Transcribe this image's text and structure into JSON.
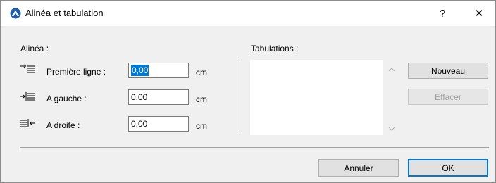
{
  "window": {
    "title": "Alinéa et tabulation",
    "help_label": "?",
    "close_label": "✕"
  },
  "indent": {
    "section_label": "Alinéa :",
    "rows": [
      {
        "label": "Première ligne :",
        "value": "0,00",
        "unit": "cm",
        "icon": "first-line-indent-icon"
      },
      {
        "label": "A gauche :",
        "value": "0,00",
        "unit": "cm",
        "icon": "left-indent-icon"
      },
      {
        "label": "A droite :",
        "value": "0,00",
        "unit": "cm",
        "icon": "right-indent-icon"
      }
    ]
  },
  "tabs": {
    "section_label": "Tabulations :",
    "items": [],
    "new_label": "Nouveau",
    "delete_label": "Effacer"
  },
  "footer": {
    "cancel_label": "Annuler",
    "ok_label": "OK"
  },
  "colors": {
    "accent": "#0078d7",
    "dialog_bg": "#f0f0f0"
  }
}
